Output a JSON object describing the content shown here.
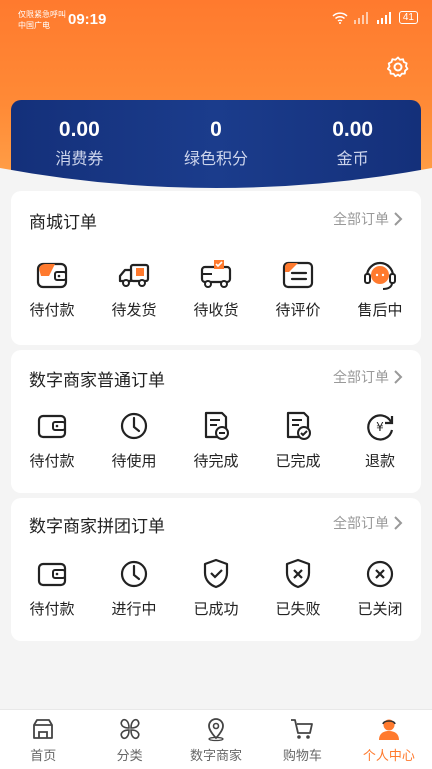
{
  "status_bar": {
    "carrier_line1": "仅限紧急呼叫",
    "carrier_line2": "中国广电",
    "time": "09:19",
    "battery": "41"
  },
  "balance": [
    {
      "value": "0.00",
      "label": "消费券"
    },
    {
      "value": "0",
      "label": "绿色积分"
    },
    {
      "value": "0.00",
      "label": "金币"
    }
  ],
  "mall_orders": {
    "title": "商城订单",
    "all_label": "全部订单",
    "items": [
      {
        "label": "待付款",
        "icon": "wallet-icon"
      },
      {
        "label": "待发货",
        "icon": "truck-icon"
      },
      {
        "label": "待收货",
        "icon": "delivery-icon"
      },
      {
        "label": "待评价",
        "icon": "comment-icon"
      },
      {
        "label": "售后中",
        "icon": "headset-icon"
      }
    ]
  },
  "merchant_orders": {
    "title": "数字商家普通订单",
    "all_label": "全部订单",
    "items": [
      {
        "label": "待付款",
        "icon": "wallet-icon"
      },
      {
        "label": "待使用",
        "icon": "clock-icon"
      },
      {
        "label": "待完成",
        "icon": "document-pending-icon"
      },
      {
        "label": "已完成",
        "icon": "document-check-icon"
      },
      {
        "label": "退款",
        "icon": "refund-icon"
      }
    ]
  },
  "group_orders": {
    "title": "数字商家拼团订单",
    "all_label": "全部订单",
    "items": [
      {
        "label": "待付款",
        "icon": "wallet-icon"
      },
      {
        "label": "进行中",
        "icon": "clock-icon"
      },
      {
        "label": "已成功",
        "icon": "shield-check-icon"
      },
      {
        "label": "已失败",
        "icon": "shield-x-icon"
      },
      {
        "label": "已关闭",
        "icon": "circle-x-icon"
      }
    ]
  },
  "bottom_nav": [
    {
      "label": "首页",
      "icon": "home-icon"
    },
    {
      "label": "分类",
      "icon": "category-icon"
    },
    {
      "label": "数字商家",
      "icon": "location-icon"
    },
    {
      "label": "购物车",
      "icon": "cart-icon"
    },
    {
      "label": "个人中心",
      "icon": "profile-icon",
      "active": true
    }
  ],
  "colors": {
    "accent": "#ff7a2e",
    "balance_bg": "#1b3c8c"
  }
}
